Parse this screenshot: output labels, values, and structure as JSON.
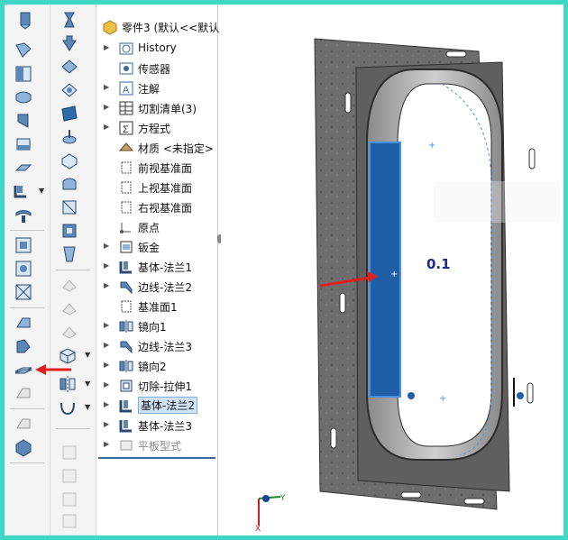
{
  "tree": {
    "root_label": "零件3 (默认<<默认",
    "items": [
      {
        "label": "History",
        "icon": "history-icon",
        "expand": "▶"
      },
      {
        "label": "传感器",
        "icon": "sensor-icon",
        "expand": ""
      },
      {
        "label": "注解",
        "icon": "annotation-icon",
        "expand": "▶"
      },
      {
        "label": "切割清单(3)",
        "icon": "cutlist-icon",
        "expand": "▶"
      },
      {
        "label": "方程式",
        "icon": "equation-icon",
        "expand": "▶"
      },
      {
        "label": "材质 <未指定>",
        "icon": "material-icon",
        "expand": ""
      },
      {
        "label": "前视基准面",
        "icon": "plane-icon",
        "expand": ""
      },
      {
        "label": "上视基准面",
        "icon": "plane-icon",
        "expand": ""
      },
      {
        "label": "右视基准面",
        "icon": "plane-icon",
        "expand": ""
      },
      {
        "label": "原点",
        "icon": "origin-icon",
        "expand": ""
      },
      {
        "label": "钣金",
        "icon": "sheetmetal-icon",
        "expand": "▶"
      },
      {
        "label": "基体-法兰1",
        "icon": "base-flange-icon",
        "expand": "▶"
      },
      {
        "label": "边线-法兰2",
        "icon": "edge-flange-icon",
        "expand": "▶"
      },
      {
        "label": "基准面1",
        "icon": "plane-icon",
        "expand": ""
      },
      {
        "label": "镜向1",
        "icon": "mirror-icon",
        "expand": "▶"
      },
      {
        "label": "边线-法兰3",
        "icon": "edge-flange-icon",
        "expand": "▶"
      },
      {
        "label": "镜向2",
        "icon": "mirror-icon",
        "expand": "▶"
      },
      {
        "label": "切除-拉伸1",
        "icon": "cut-extrude-icon",
        "expand": "▶"
      },
      {
        "label": "基体-法兰2",
        "icon": "base-flange-icon",
        "expand": "▶"
      },
      {
        "label": "基体-法兰3",
        "icon": "base-flange-icon",
        "expand": "▶"
      },
      {
        "label": "平板型式",
        "icon": "flat-pattern-icon",
        "expand": "▶"
      }
    ]
  },
  "viewport": {
    "dimension_label": "0.1",
    "triad": {
      "x_label": "X",
      "y_label": "Y"
    }
  },
  "colors": {
    "highlight_face": "#1f5fa8",
    "red_arrow": "#e02020",
    "sheet_metal": "#6b6b6b",
    "frame_border": "#3fd6c6"
  }
}
